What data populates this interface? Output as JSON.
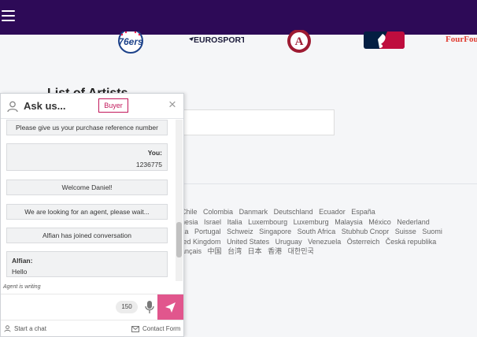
{
  "header": {
    "menu_icon": "hamburger-icon",
    "brand_color": "#2d0a57"
  },
  "logos": {
    "items": [
      "76ers",
      "EUROSPORT",
      "Alabama",
      "MLB",
      "FourFour"
    ]
  },
  "page": {
    "title": "List of Artists"
  },
  "countries": {
    "rows": [
      [
        "Chile",
        "Colombia",
        "Danmark",
        "Deutschland",
        "Ecuador",
        "España"
      ],
      [
        "nesia",
        "Israel",
        "Italia",
        "Luxembourg",
        "Luxemburg",
        "Malaysia",
        "México",
        "Nederland"
      ],
      [
        "ka",
        "Portugal",
        "Schweiz",
        "Singapore",
        "South Africa",
        "Stubhub Cnopr",
        "Suisse",
        "Suomi"
      ],
      [
        "ted Kingdom",
        "United States",
        "Uruguay",
        "Venezuela",
        "Österreich",
        "Česká republika"
      ],
      [
        "ançais",
        "中国",
        "台湾",
        "日本",
        "香港",
        "대한민국"
      ]
    ]
  },
  "chat": {
    "title": "Ask us...",
    "badge": "Buyer",
    "close_label": "×",
    "messages": {
      "m1": "Please give us your purchase reference number",
      "m2_who": "You:",
      "m2_text": "1236775",
      "m3": "Welcome Daniel!",
      "m4": "We are looking for an agent, please wait...",
      "m5": "Alfian has joined conversation",
      "m6_who": "Alfian:",
      "m6_text": "Hello"
    },
    "typing_status": "Agent is writing",
    "char_count": "150",
    "start_chat": "Start a chat",
    "contact_form": "Contact Form",
    "accent_color": "#e1568d"
  }
}
